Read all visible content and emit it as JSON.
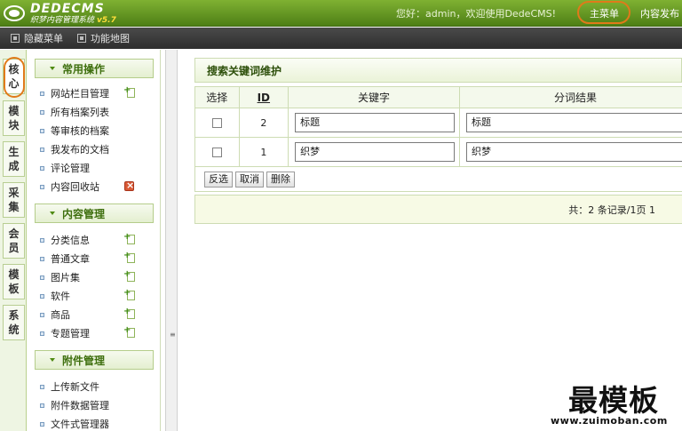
{
  "header": {
    "brand": "DEDECMS",
    "subtitle": "织梦内容管理系统",
    "version": "v5.7",
    "welcome": "您好：admin，欢迎使用DedeCMS!",
    "main_menu": "主菜单",
    "content_publish": "内容发布"
  },
  "subbar": {
    "hide_menu": "隐藏菜单",
    "function_map": "功能地图"
  },
  "vtabs": [
    {
      "label": "核心"
    },
    {
      "label": "模块"
    },
    {
      "label": "生成"
    },
    {
      "label": "采集"
    },
    {
      "label": "会员"
    },
    {
      "label": "模板"
    },
    {
      "label": "系统"
    }
  ],
  "menu": {
    "sections": [
      {
        "title": "常用操作",
        "items": [
          "网站栏目管理",
          "所有档案列表",
          "等审核的档案",
          "我发布的文档",
          "评论管理",
          "内容回收站"
        ]
      },
      {
        "title": "内容管理",
        "items": [
          "分类信息",
          "普通文章",
          "图片集",
          "软件",
          "商品",
          "专题管理"
        ]
      },
      {
        "title": "附件管理",
        "items": [
          "上传新文件",
          "附件数据管理",
          "文件式管理器"
        ]
      }
    ]
  },
  "main": {
    "title": "搜索关键词维护",
    "columns": [
      "选择",
      "ID",
      "关键字",
      "分词结果"
    ],
    "rows": [
      {
        "id": "2",
        "keyword": "标题",
        "result": "标题"
      },
      {
        "id": "1",
        "keyword": "织梦",
        "result": "织梦"
      }
    ],
    "buttons": {
      "select_invert": "反选",
      "cancel": "取消",
      "delete": "删除"
    },
    "footer": "共：2 条记录/1页 1"
  },
  "watermark": {
    "text": "最模板",
    "url": "www.zuimoban.com"
  }
}
